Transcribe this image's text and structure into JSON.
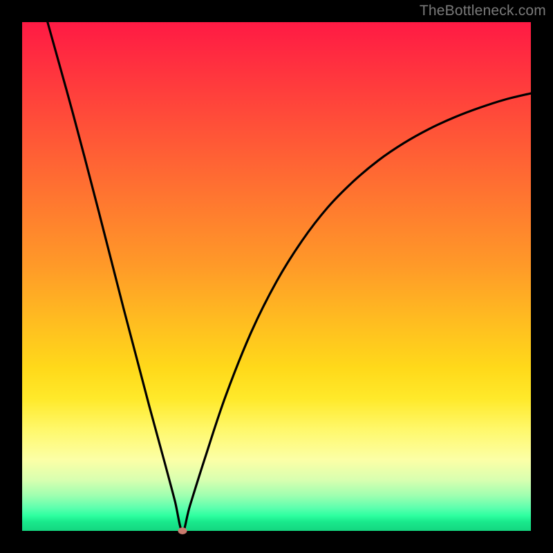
{
  "watermark": "TheBottleneck.com",
  "colors": {
    "background": "#000000",
    "curve_stroke": "#000000",
    "marker_fill": "#c97b6e"
  },
  "chart_data": {
    "type": "line",
    "title": "",
    "xlabel": "",
    "ylabel": "",
    "xlim": [
      0,
      100
    ],
    "ylim": [
      0,
      100
    ],
    "grid": false,
    "legend": false,
    "notes": "Bottleneck-style V curve; y is fraction of plot height from bottom. Minimum ≈ x=31.5.",
    "series": [
      {
        "name": "curve",
        "x": [
          5,
          10,
          15,
          20,
          25,
          28,
          30,
          31.5,
          33,
          36,
          40,
          45,
          50,
          55,
          60,
          65,
          70,
          75,
          80,
          85,
          90,
          95,
          100
        ],
        "values": [
          100,
          82,
          63,
          43.5,
          24.5,
          13.5,
          6,
          0,
          5,
          14.5,
          26.5,
          39,
          49,
          57,
          63.5,
          68.6,
          72.8,
          76.2,
          79,
          81.3,
          83.2,
          84.8,
          86
        ]
      }
    ],
    "marker": {
      "x": 31.5,
      "y": 0
    }
  }
}
